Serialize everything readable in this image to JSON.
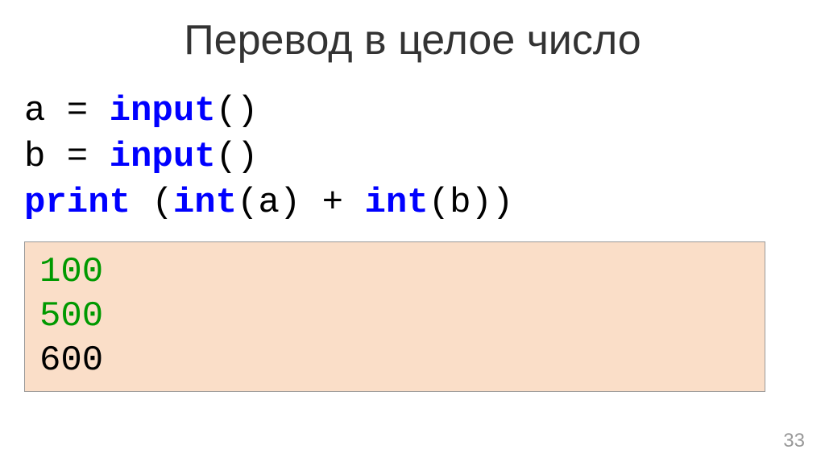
{
  "title": "Перевод в целое число",
  "code": {
    "line1": {
      "p1": "a = ",
      "p2": "input",
      "p3": "()"
    },
    "line2": {
      "p1": "b = ",
      "p2": "input",
      "p3": "()"
    },
    "line3": {
      "p1": "print",
      "p2": " (",
      "p3": "int",
      "p4": "(a) + ",
      "p5": "int",
      "p6": "(b))"
    }
  },
  "output": {
    "line1": "100",
    "line2": "500",
    "line3": "600"
  },
  "page_number": "33"
}
